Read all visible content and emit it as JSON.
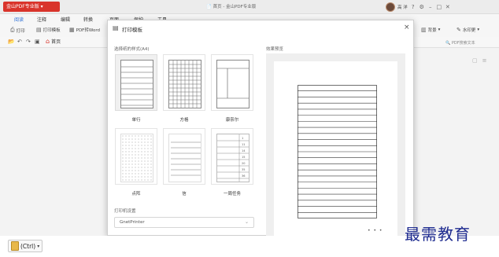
{
  "app": {
    "badge_label": "金山PDF专业版",
    "window_title": "首页 - 金山PDF专业版",
    "user_name": "高 洋",
    "window_icons": [
      "help-icon",
      "settings-icon",
      "minimize-icon",
      "maximize-icon",
      "close-icon"
    ]
  },
  "ribbon": {
    "tabs": [
      "阅读",
      "注释",
      "编辑",
      "转换",
      "页面",
      "保护",
      "工具"
    ],
    "active_tab": "阅读"
  },
  "toolbar": {
    "print": "打印",
    "print_template": "打印模板",
    "pdf_to": "PDF转Word",
    "background": "背景",
    "watermark_tool": "水印更"
  },
  "nav": {
    "home_tab": "首页",
    "search_hint": "PDF搜索文本"
  },
  "dialog": {
    "title": "打印模板",
    "section_style": "选择纸的样式(A4)",
    "section_preview": "效果预览",
    "section_printer": "打印机设置",
    "printer_value": "GnetPrinter",
    "selected_template": "单行",
    "templates": [
      {
        "label": "单行",
        "kind": "lines",
        "selected": true
      },
      {
        "label": "方格",
        "kind": "grid",
        "selected": false
      },
      {
        "label": "康奈尔",
        "kind": "cornell",
        "selected": false
      },
      {
        "label": "点阵",
        "kind": "dots",
        "selected": false
      },
      {
        "label": "信",
        "kind": "letter",
        "selected": false
      },
      {
        "label": "一周任务",
        "kind": "week",
        "selected": false
      }
    ],
    "week_numbers": [
      "1",
      "11",
      "14",
      "15",
      "20",
      "35",
      "36"
    ],
    "preview_line_count": 22
  },
  "watermark_text": "最需教育",
  "paste_option": {
    "label": "(Ctrl)"
  },
  "colors": {
    "badge_red": "#d9342b",
    "active_tab_blue": "#2b6fd6",
    "watermark_blue": "#1d2a8f"
  }
}
